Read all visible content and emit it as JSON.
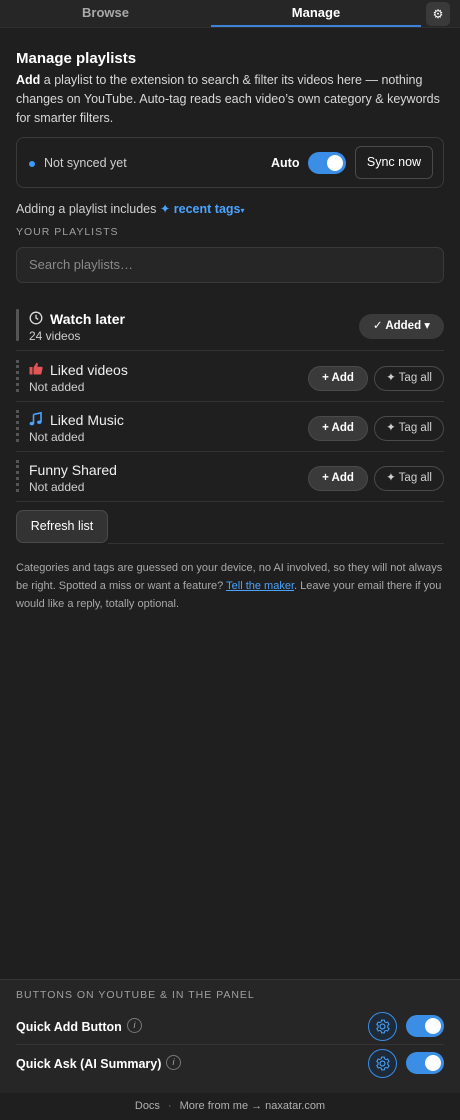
{
  "tabs": {
    "browse": "Browse",
    "manage": "Manage"
  },
  "header": {
    "title": "Manage playlists",
    "intro_bold": "Add",
    "intro_rest": " a playlist to the extension to search & filter its videos here — nothing changes on YouTube. Auto-tag reads each video’s own category & keywords for smarter filters."
  },
  "sync": {
    "status": "Not synced yet",
    "auto_label": "Auto",
    "auto_on": true,
    "sync_button": "Sync now"
  },
  "adding": {
    "text": "Adding a playlist includes ",
    "link": "✦ recent tags",
    "caret": "▾"
  },
  "section_label": "YOUR PLAYLISTS",
  "search": {
    "placeholder": "Search playlists…"
  },
  "playlists": [
    {
      "name": "Watch later",
      "sub": "24 videos",
      "icon": "clock-icon",
      "state": "added",
      "action": "✓ Added ▾"
    },
    {
      "name": "Liked videos",
      "sub": "Not added",
      "icon": "thumbs-up-icon",
      "state": "not-added",
      "add": "+ Add",
      "tag": "✦ Tag all"
    },
    {
      "name": "Liked Music",
      "sub": "Not added",
      "icon": "music-note-icon",
      "state": "not-added",
      "add": "+ Add",
      "tag": "✦ Tag all"
    },
    {
      "name": "Funny Shared",
      "sub": "Not added",
      "icon": "",
      "state": "not-added",
      "add": "+ Add",
      "tag": "✦ Tag all"
    }
  ],
  "refresh_button": "Refresh list",
  "note": {
    "part1": "Categories and tags are guessed on your device, no AI involved, so they will not always be right. Spotted a miss or want a feature? ",
    "link": "Tell the maker",
    "part2": ". Leave your email there if you would like a reply, totally optional."
  },
  "bottom_panel": {
    "label": "BUTTONS ON YOUTUBE & IN THE PANEL",
    "items": [
      {
        "name": "Quick Add Button",
        "enabled": true
      },
      {
        "name": "Quick Ask (AI Summary)",
        "enabled": true
      }
    ]
  },
  "footer": {
    "docs": "Docs",
    "sep": "·",
    "more": "More from me → naxatar.com"
  },
  "colors": {
    "accent": "#3b8ee6",
    "link": "#4aa3ff",
    "background": "#1f1f1f",
    "liked_red": "#e05555"
  }
}
